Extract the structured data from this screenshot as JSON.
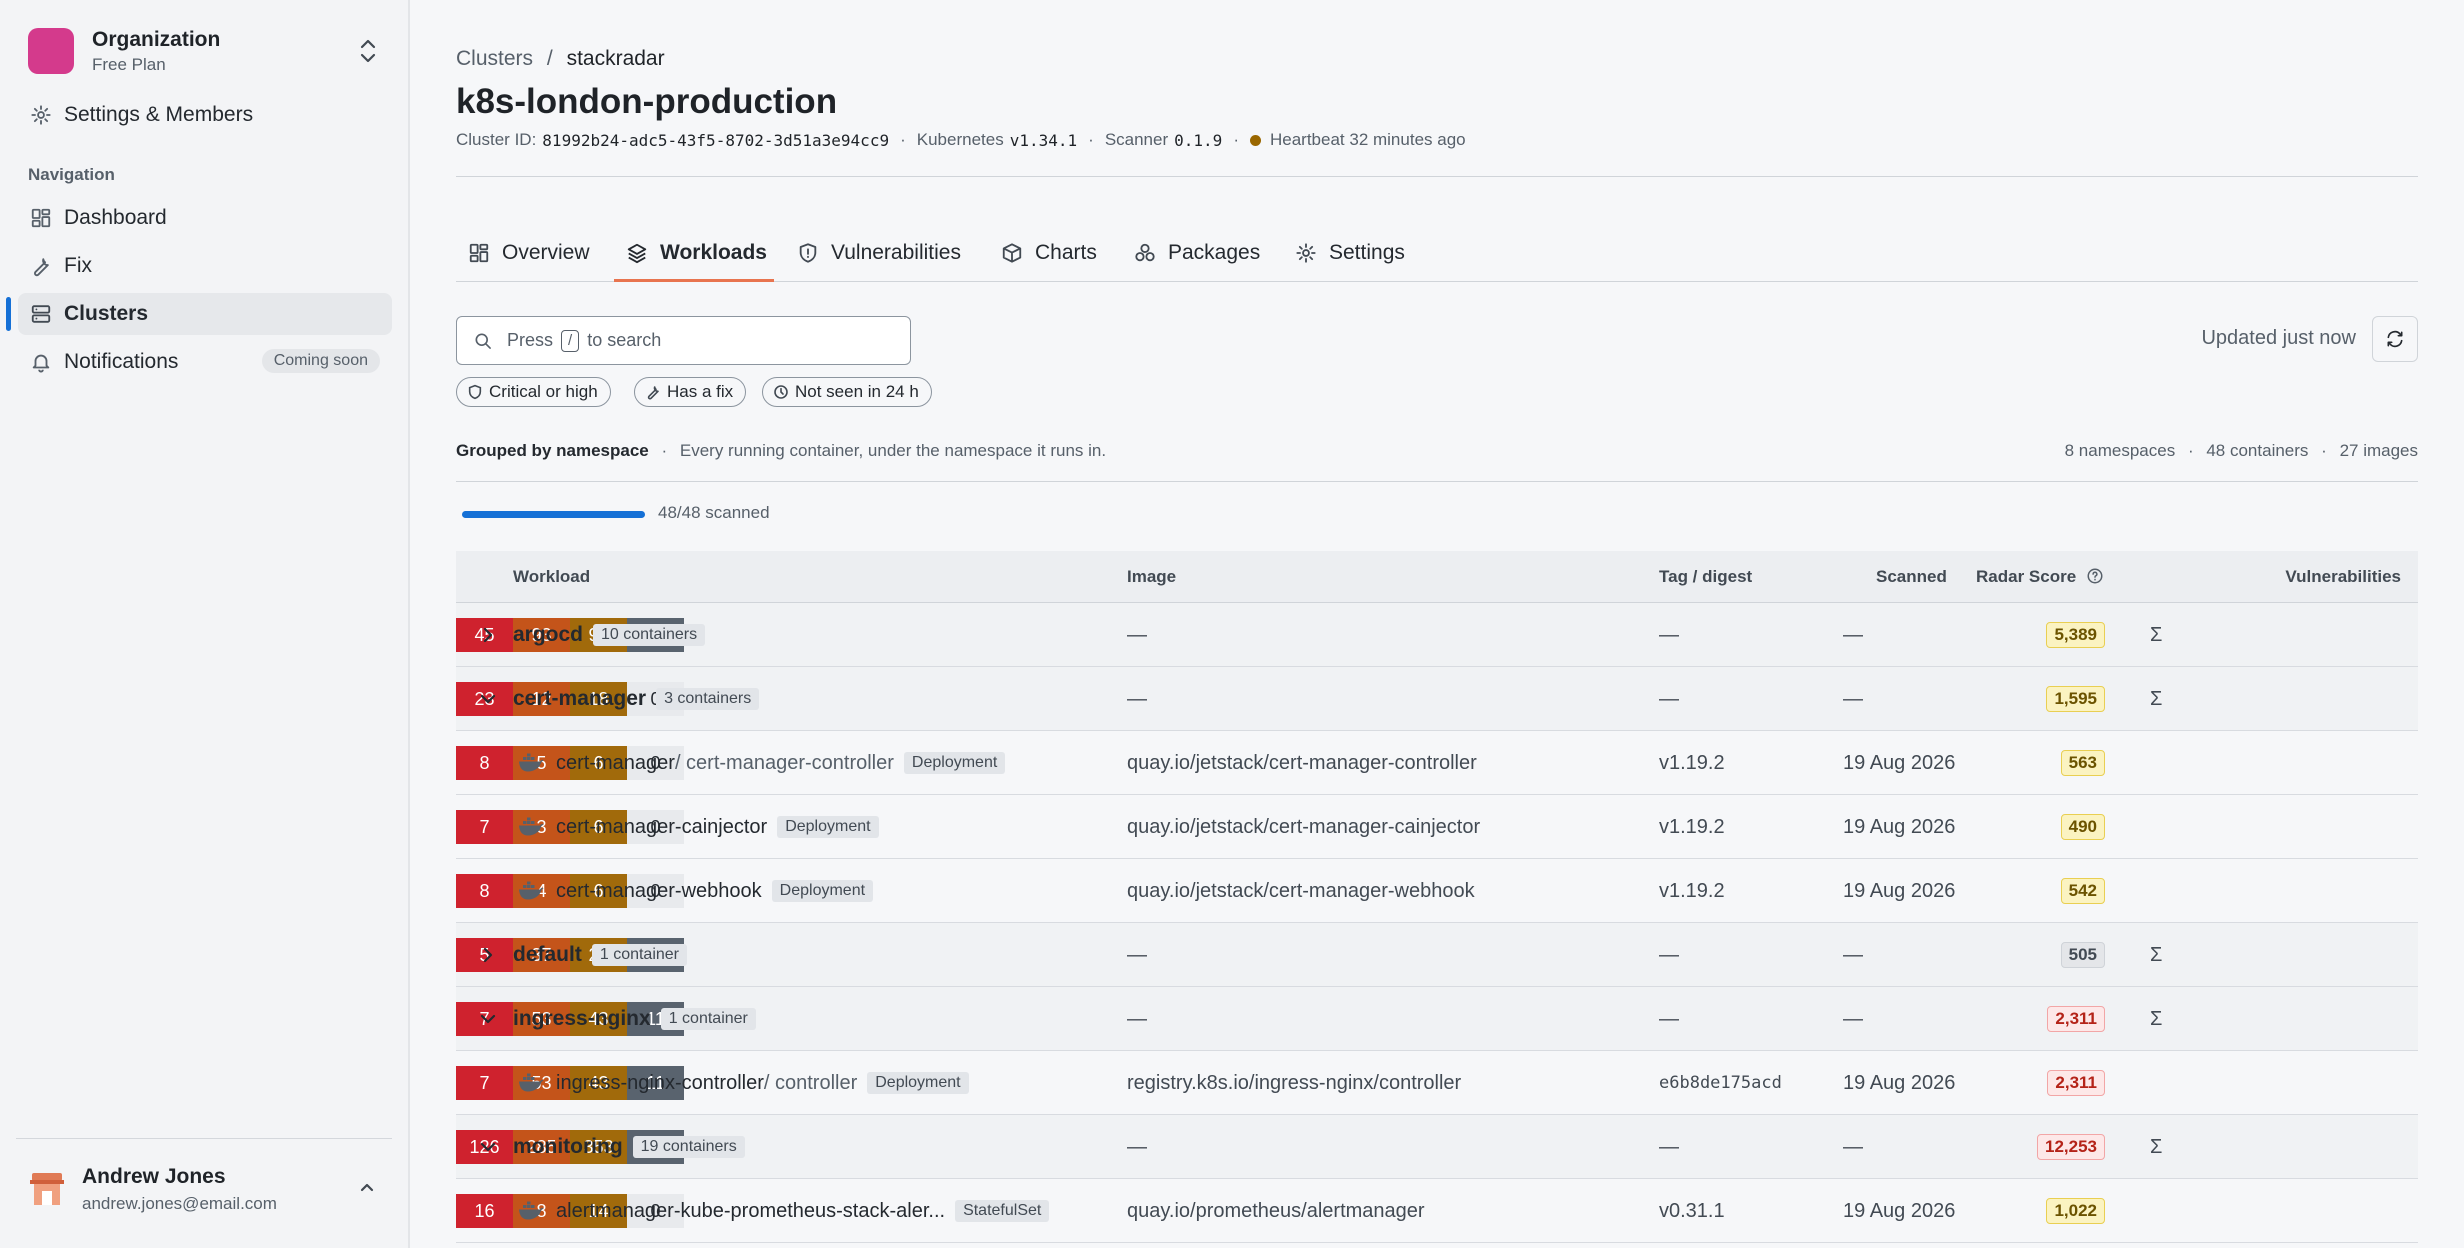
{
  "sidebar": {
    "org_name": "Organization",
    "org_plan": "Free Plan",
    "settings_label": "Settings & Members",
    "nav_heading": "Navigation",
    "items": [
      {
        "label": "Dashboard"
      },
      {
        "label": "Fix"
      },
      {
        "label": "Clusters"
      },
      {
        "label": "Notifications",
        "badge": "Coming soon"
      }
    ],
    "user_name": "Andrew Jones",
    "user_email": "andrew.jones@email.com"
  },
  "breadcrumb": {
    "root": "Clusters",
    "sep": "/",
    "current": "stackradar"
  },
  "page_title": "k8s-london-production",
  "meta": {
    "cluster_id_label": "Cluster ID:",
    "cluster_id": "81992b24-adc5-43f5-8702-3d51a3e94cc9",
    "kubernetes_label": "Kubernetes",
    "kubernetes_version": "v1.34.1",
    "scanner_label": "Scanner",
    "scanner_version": "0.1.9",
    "heartbeat": "Heartbeat 32 minutes ago",
    "heartbeat_color": "#9a6700"
  },
  "tabs": [
    {
      "label": "Overview",
      "icon": "grid-icon"
    },
    {
      "label": "Workloads",
      "icon": "layers-icon",
      "active": true
    },
    {
      "label": "Vulnerabilities",
      "icon": "shield-icon"
    },
    {
      "label": "Charts",
      "icon": "box-icon"
    },
    {
      "label": "Packages",
      "icon": "packages-icon"
    },
    {
      "label": "Settings",
      "icon": "gear-icon"
    }
  ],
  "search": {
    "prefix": "Press",
    "key": "/",
    "suffix": "to search"
  },
  "updated": "Updated just now",
  "filters": [
    "Critical or high",
    "Has a fix",
    "Not seen in 24 h"
  ],
  "grouping": {
    "label": "Grouped by namespace",
    "description": "Every running container, under the namespace it runs in."
  },
  "counts": {
    "namespaces": "8 namespaces",
    "containers": "48 containers",
    "images": "27 images"
  },
  "scan_progress": {
    "label": "48/48 scanned",
    "fraction": 1.0
  },
  "table": {
    "headers": {
      "workload": "Workload",
      "image": "Image",
      "tag": "Tag / digest",
      "scanned": "Scanned",
      "score": "Radar Score",
      "vulns": "Vulnerabilities"
    },
    "sigma": "Σ",
    "dash": "—",
    "rows": [
      {
        "kind": "group",
        "expanded": false,
        "name": "argocd",
        "count": "10 containers",
        "score": "5,389",
        "score_level": "yellow",
        "vulns": [
          "45",
          "93",
          "94",
          "18"
        ]
      },
      {
        "kind": "group",
        "expanded": true,
        "name": "cert-manager",
        "count": "3 containers",
        "score": "1,595",
        "score_level": "yellow",
        "vulns": [
          "23",
          "12",
          "18",
          "0"
        ]
      },
      {
        "kind": "child",
        "name": "cert-manager",
        "sub": " / cert-manager-controller",
        "type": "Deployment",
        "image": "quay.io/jetstack/cert-manager-controller",
        "tag": "v1.19.2",
        "scanned": "19 Aug 2026",
        "score": "563",
        "score_level": "yellow",
        "vulns": [
          "8",
          "5",
          "6",
          "0"
        ]
      },
      {
        "kind": "child",
        "name": "cert-manager-cainjector",
        "sub": "",
        "type": "Deployment",
        "image": "quay.io/jetstack/cert-manager-cainjector",
        "tag": "v1.19.2",
        "scanned": "19 Aug 2026",
        "score": "490",
        "score_level": "yellow",
        "vulns": [
          "7",
          "3",
          "6",
          "0"
        ]
      },
      {
        "kind": "child",
        "name": "cert-manager-webhook",
        "sub": "",
        "type": "Deployment",
        "image": "quay.io/jetstack/cert-manager-webhook",
        "tag": "v1.19.2",
        "scanned": "19 Aug 2026",
        "score": "542",
        "score_level": "yellow",
        "vulns": [
          "8",
          "4",
          "6",
          "0"
        ]
      },
      {
        "kind": "group",
        "expanded": false,
        "name": "default",
        "count": "1 container",
        "score": "505",
        "score_level": "grey",
        "vulns": [
          "5",
          "37",
          "27",
          "4"
        ]
      },
      {
        "kind": "group",
        "expanded": true,
        "name": "ingress-nginx",
        "count": "1 container",
        "score": "2,311",
        "score_level": "red",
        "vulns": [
          "7",
          "53",
          "43",
          "11"
        ]
      },
      {
        "kind": "child",
        "name": "ingress-nginx-controller",
        "sub": " / controller",
        "type": "Deployment",
        "image": "registry.k8s.io/ingress-nginx/controller",
        "tag": "e6b8de175acd",
        "tag_mono": true,
        "scanned": "19 Aug 2026",
        "score": "2,311",
        "score_level": "red",
        "vulns": [
          "7",
          "53",
          "43",
          "11"
        ]
      },
      {
        "kind": "group",
        "expanded": true,
        "name": "monitoring",
        "count": "19 containers",
        "score": "12,253",
        "score_level": "red",
        "vulns": [
          "126",
          "285",
          "353",
          "42"
        ]
      },
      {
        "kind": "child",
        "name": "alertmanager-kube-prometheus-stack-aler...",
        "sub": "",
        "type": "StatefulSet",
        "image": "quay.io/prometheus/alertmanager",
        "tag": "v0.31.1",
        "scanned": "19 Aug 2026",
        "score": "1,022",
        "score_level": "yellow",
        "vulns": [
          "16",
          "8",
          "14",
          "0"
        ]
      }
    ]
  },
  "colors": {
    "accent": "#1570d6",
    "tab_underline": "#e8744f",
    "critical": "#cf222e",
    "high": "#c4541a",
    "medium": "#a16a0b",
    "low": "#59636e",
    "org_logo": "#d43a8c"
  }
}
